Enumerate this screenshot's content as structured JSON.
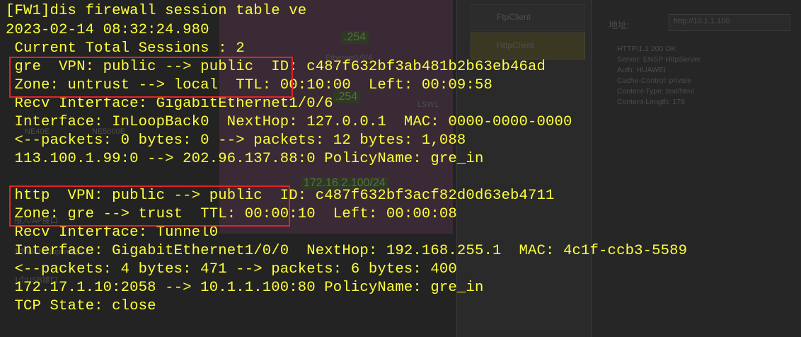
{
  "background": {
    "topology_labels": [
      ".254",
      "Ethernet1/0/4",
      ".254",
      "NE40E",
      "NE5000E",
      "172.16.2.100/24",
      "LSW1"
    ],
    "side_notes": [
      "接入/AP接口",
      "1个WAN口uplink接口",
      "1个USB接口"
    ],
    "client_apps": [
      "FtpClient",
      "HttpClient"
    ],
    "address_label": "地址:",
    "address_value": "http://10.1.1.100",
    "http_response": [
      "HTTP/1.1 200 OK",
      "Server: ENSP HttpServer",
      "Auth: HUAWEI",
      "Cache-Control: private",
      "Content-Type: text/html",
      "Content-Length: 179"
    ]
  },
  "colors": {
    "terminal_text": "#ffff3c",
    "highlight_box": "#e02424",
    "terminal_bg": "#1c1c1c"
  },
  "terminal": {
    "lines": [
      "[FW1]dis firewall session table ve",
      "2023-02-14 08:32:24.980",
      " Current Total Sessions : 2",
      " gre  VPN: public --> public  ID: c487f632bf3ab481b2b63eb46ad",
      " Zone: untrust --> local  TTL: 00:10:00  Left: 00:09:58",
      " Recv Interface: GigabitEthernet1/0/6",
      " Interface: InLoopBack0  NextHop: 127.0.0.1  MAC: 0000-0000-0000",
      " <--packets: 0 bytes: 0 --> packets: 12 bytes: 1,088",
      " 113.100.1.99:0 --> 202.96.137.88:0 PolicyName: gre_in",
      "",
      " http  VPN: public --> public  ID: c487f632bf3acf82d0d63eb4711",
      " Zone: gre --> trust  TTL: 00:00:10  Left: 00:00:08",
      " Recv Interface: Tunnel0",
      " Interface: GigabitEthernet1/0/0  NextHop: 192.168.255.1  MAC: 4c1f-ccb3-5589",
      " <--packets: 4 bytes: 471 --> packets: 6 bytes: 400",
      " 172.17.1.10:2058 --> 10.1.1.100:80 PolicyName: gre_in",
      " TCP State: close"
    ]
  }
}
